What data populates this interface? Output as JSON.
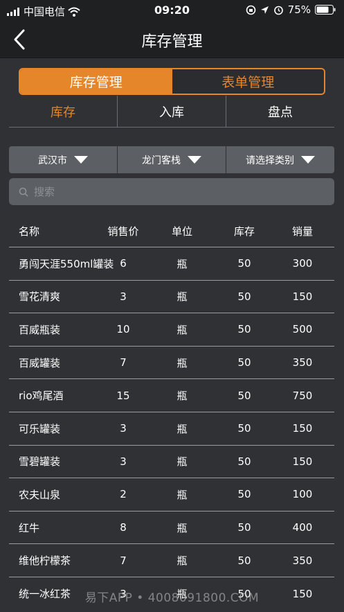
{
  "status_bar": {
    "carrier": "中国电信",
    "time": "09:20",
    "battery": "75%"
  },
  "nav": {
    "title": "库存管理"
  },
  "segments": [
    {
      "label": "库存管理",
      "active": true
    },
    {
      "label": "表单管理",
      "active": false
    }
  ],
  "subtabs": [
    {
      "label": "库存",
      "active": true
    },
    {
      "label": "入库",
      "active": false
    },
    {
      "label": "盘点",
      "active": false
    }
  ],
  "filters": {
    "city": "武汉市",
    "store": "龙门客栈",
    "category": "请选择类别"
  },
  "search": {
    "placeholder": "搜索"
  },
  "table": {
    "headers": [
      "名称",
      "销售价",
      "单位",
      "库存",
      "销量"
    ],
    "rows": [
      [
        "勇闯天涯550ml罐装",
        "6",
        "瓶",
        "50",
        "300"
      ],
      [
        "雪花清爽",
        "3",
        "瓶",
        "50",
        "150"
      ],
      [
        "百威瓶装",
        "10",
        "瓶",
        "50",
        "500"
      ],
      [
        "百威罐装",
        "7",
        "瓶",
        "50",
        "350"
      ],
      [
        "rio鸡尾酒",
        "15",
        "瓶",
        "50",
        "750"
      ],
      [
        "可乐罐装",
        "3",
        "瓶",
        "50",
        "150"
      ],
      [
        "雪碧罐装",
        "3",
        "瓶",
        "50",
        "150"
      ],
      [
        "农夫山泉",
        "2",
        "瓶",
        "50",
        "100"
      ],
      [
        "红牛",
        "8",
        "瓶",
        "50",
        "400"
      ],
      [
        "维他柠檬茶",
        "7",
        "瓶",
        "50",
        "350"
      ],
      [
        "统一冰红茶",
        "3",
        "瓶",
        "50",
        "150"
      ]
    ]
  },
  "watermark": "易下APP • 4008091800.COM",
  "colors": {
    "accent": "#e6862a",
    "background": "#2f3134",
    "bar": "#1f2022",
    "control": "#5c5f63"
  }
}
